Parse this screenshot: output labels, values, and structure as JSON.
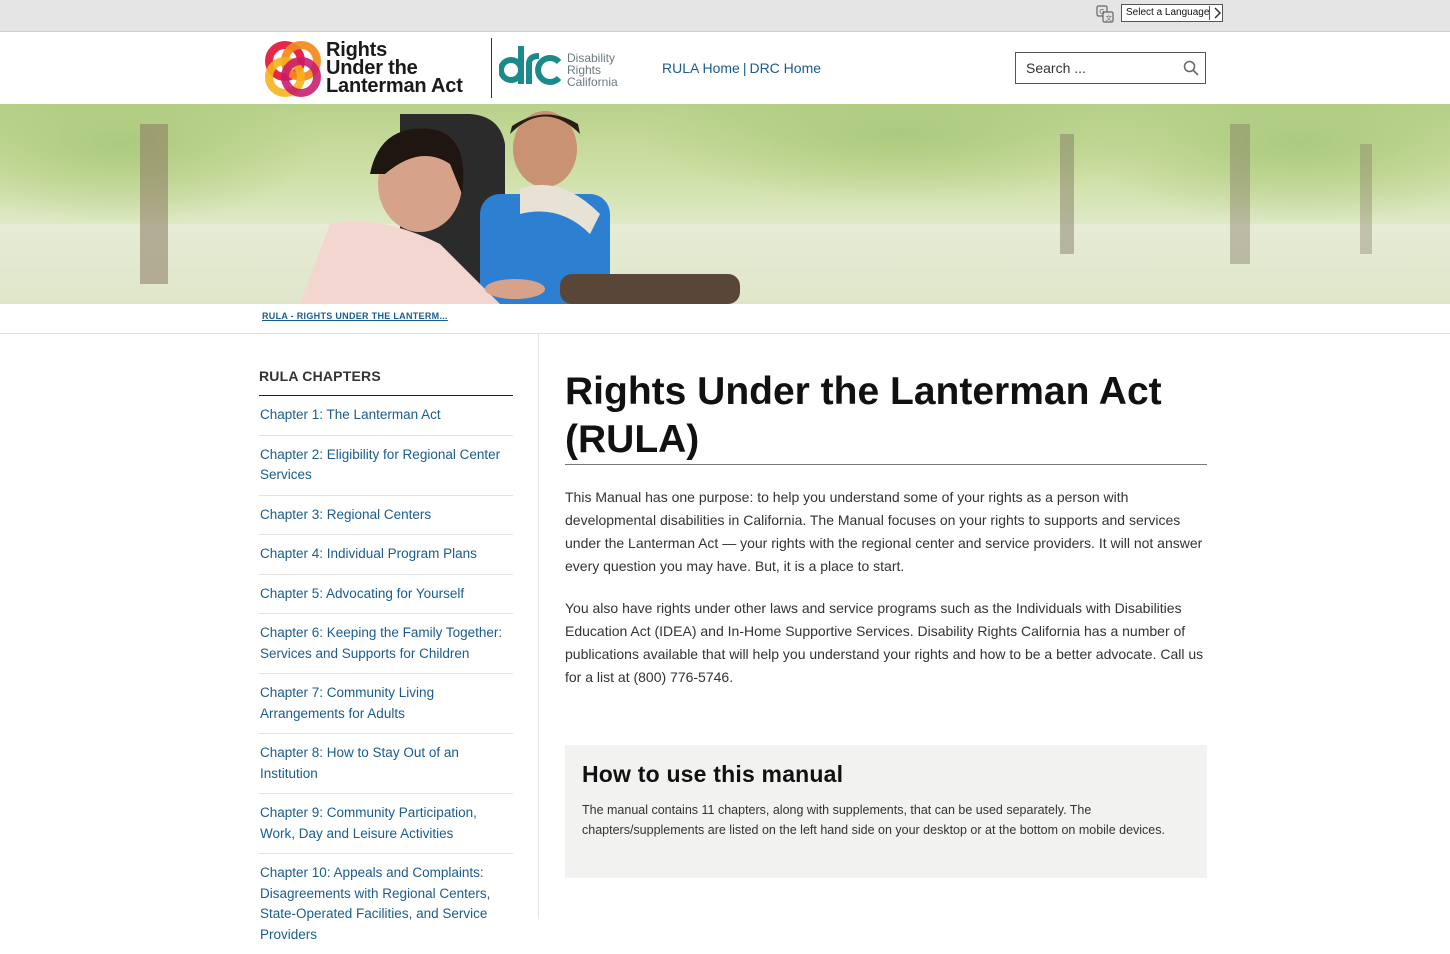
{
  "topbar": {
    "language_select": "Select a Language"
  },
  "header": {
    "rula_logo_lines": [
      "Rights",
      "Under the",
      "Lanterman Act"
    ],
    "drc_logo_lines": [
      "Disability",
      "Rights",
      "California"
    ],
    "nav": {
      "rula_home": "RULA Home",
      "separator": "|",
      "drc_home": "DRC Home"
    },
    "search_placeholder": "Search ..."
  },
  "breadcrumb": "RULA - RIGHTS UNDER THE LANTERM...",
  "sidebar": {
    "heading": "RULA CHAPTERS",
    "items": [
      {
        "label": "Chapter 1: The Lanterman Act"
      },
      {
        "label": "Chapter 2: Eligibility for Regional Center Services"
      },
      {
        "label": "Chapter 3: Regional Centers"
      },
      {
        "label": "Chapter 4: Individual Program Plans"
      },
      {
        "label": "Chapter 5: Advocating for Yourself"
      },
      {
        "label": "Chapter 6: Keeping the Family Together: Services and Supports for Children"
      },
      {
        "label": "Chapter 7: Community Living Arrangements for Adults"
      },
      {
        "label": "Chapter 8: How to Stay Out of an Institution"
      },
      {
        "label": "Chapter 9: Community Participation, Work, Day and Leisure Activities"
      },
      {
        "label": "Chapter 10: Appeals and Complaints: Disagreements with Regional Centers, State-Operated Facilities, and Service Providers"
      }
    ]
  },
  "main": {
    "title": "Rights Under the Lanterman Act (RULA)",
    "paragraph1": "This Manual has one purpose: to help you understand some of your rights as a person with developmental disabilities in California. The Manual focuses on your rights to supports and services under the Lanterman Act — your rights with the regional center and service providers. It will not answer every question you may have. But, it is a place to start.",
    "paragraph2": "You also have rights under other laws and service programs such as the Individuals with Disabilities Education Act (IDEA) and In-Home Supportive Services. Disability Rights California has a number of publications available that will help you understand your rights and how to be a better advocate. Call us for a list at (800) 776-5746.",
    "howto": {
      "heading": "How to use this manual",
      "text": "The manual contains 11 chapters, along with supplements, that can be used separately. The chapters/supplements are listed on the left hand side on your desktop or at the bottom on mobile devices."
    }
  },
  "colors": {
    "link": "#1a5c8e",
    "drc_teal": "#1a8a8c",
    "howto_bg": "#f2f2f0"
  }
}
